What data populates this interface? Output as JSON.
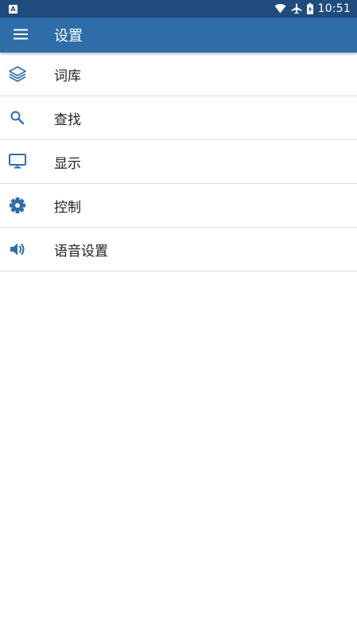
{
  "status_bar": {
    "notification_icon": "A",
    "time": "10:51",
    "icons": [
      "wifi-icon",
      "airplane-icon",
      "battery-charging-icon"
    ]
  },
  "app_bar": {
    "title": "设置",
    "menu_icon": "hamburger-menu-icon"
  },
  "menu": {
    "items": [
      {
        "label": "词库",
        "icon": "layers-icon"
      },
      {
        "label": "查找",
        "icon": "search-icon"
      },
      {
        "label": "显示",
        "icon": "monitor-icon"
      },
      {
        "label": "控制",
        "icon": "gear-icon"
      },
      {
        "label": "语音设置",
        "icon": "volume-icon"
      }
    ]
  },
  "colors": {
    "status_bar": "#1f4c7d",
    "app_bar": "#2e6da8",
    "icon": "#2e6da8",
    "divider": "#dcdcdc",
    "text": "#222222"
  }
}
